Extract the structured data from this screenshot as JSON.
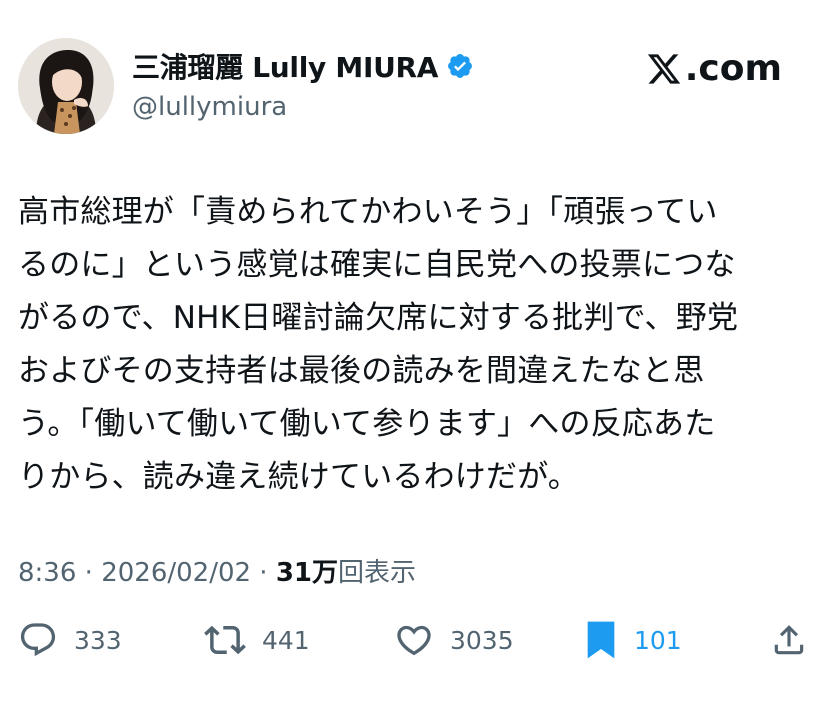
{
  "author": {
    "display_name": "三浦瑠麗 Lully MIURA",
    "handle": "@lullymiura",
    "verified": true,
    "avatar_icon": "profile-photo"
  },
  "brand": {
    "label": ".com",
    "icon": "x-logo-icon"
  },
  "tweet": {
    "lines": [
      "高市総理が「責められてかわいそう」「頑張ってい",
      "るのに」という感覚は確実に自民党への投票につな",
      "がるので、NHK日曜討論欠席に対する批判で、野党",
      "およびその支持者は最後の読みを間違えたなと思",
      "う。「働いて働いて働いて参ります」への反応あた",
      "りから、読み違え続けているわけだが。"
    ]
  },
  "meta": {
    "time": "8:36",
    "separator": " · ",
    "date": "2026/02/02",
    "views_count": "31万",
    "views_label": "回表示"
  },
  "actions": {
    "reply": {
      "icon": "reply-icon",
      "count": "333"
    },
    "repost": {
      "icon": "repost-icon",
      "count": "441"
    },
    "like": {
      "icon": "heart-icon",
      "count": "3035"
    },
    "bookmark": {
      "icon": "bookmark-icon",
      "count": "101",
      "active": true
    },
    "share": {
      "icon": "share-icon"
    }
  },
  "colors": {
    "text": "#0f1419",
    "secondary": "#536471",
    "accent": "#1d9bf0"
  }
}
